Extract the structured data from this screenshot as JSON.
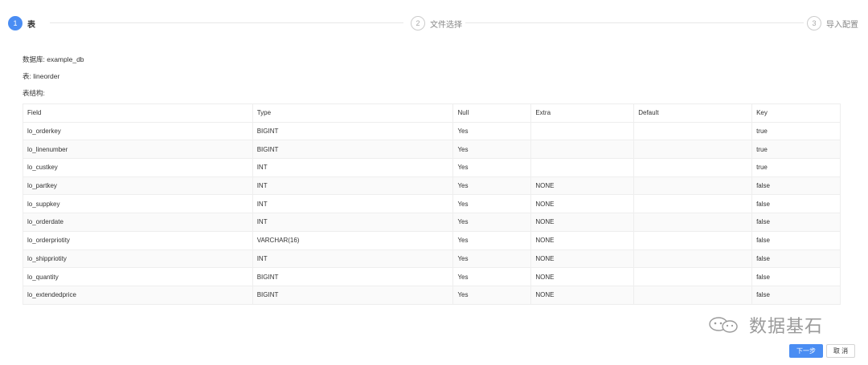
{
  "steps": [
    {
      "num": "1",
      "title": "表",
      "state": "active"
    },
    {
      "num": "2",
      "title": "文件选择",
      "state": "inactive"
    },
    {
      "num": "3",
      "title": "导入配置",
      "state": "inactive"
    }
  ],
  "info": {
    "database": "数据库: example_db",
    "table": "表: lineorder",
    "structure": "表结构:"
  },
  "table": {
    "headers": [
      "Field",
      "Type",
      "Null",
      "Extra",
      "Default",
      "Key"
    ],
    "rows": [
      [
        "lo_orderkey",
        "BIGINT",
        "Yes",
        "",
        "",
        "true"
      ],
      [
        "lo_linenumber",
        "BIGINT",
        "Yes",
        "",
        "",
        "true"
      ],
      [
        "lo_custkey",
        "INT",
        "Yes",
        "",
        "",
        "true"
      ],
      [
        "lo_partkey",
        "INT",
        "Yes",
        "NONE",
        "",
        "false"
      ],
      [
        "lo_suppkey",
        "INT",
        "Yes",
        "NONE",
        "",
        "false"
      ],
      [
        "lo_orderdate",
        "INT",
        "Yes",
        "NONE",
        "",
        "false"
      ],
      [
        "lo_orderpriotity",
        "VARCHAR(16)",
        "Yes",
        "NONE",
        "",
        "false"
      ],
      [
        "lo_shippriotity",
        "INT",
        "Yes",
        "NONE",
        "",
        "false"
      ],
      [
        "lo_quantity",
        "BIGINT",
        "Yes",
        "NONE",
        "",
        "false"
      ],
      [
        "lo_extendedprice",
        "BIGINT",
        "Yes",
        "NONE",
        "",
        "false"
      ]
    ]
  },
  "watermark": {
    "text": "数据基石",
    "icon": "wechat-icon"
  },
  "buttons": {
    "next": "下一步",
    "cancel": "取 消"
  },
  "colors": {
    "accent": "#4a8df3"
  }
}
